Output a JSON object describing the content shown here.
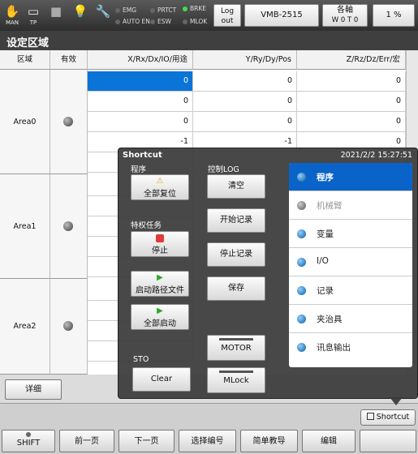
{
  "topbar": {
    "icons": [
      {
        "name": "man-icon",
        "label": "MAN"
      },
      {
        "name": "tp-icon",
        "label": "TP"
      },
      {
        "name": "stop-square-icon",
        "label": ""
      },
      {
        "name": "lightbulb-icon",
        "label": ""
      },
      {
        "name": "wrench-warning-icon",
        "label": ""
      }
    ],
    "indicators": {
      "emg": "EMG",
      "auto_en": "AUTO EN",
      "prtct": "PRTCT",
      "esw": "ESW",
      "brke": "BRKE",
      "mlok": "MLOK"
    },
    "logout_label": "Log out",
    "robot_label": "VMB-2515",
    "axis_label": "各軸",
    "axis_sub": "W 0 T 0",
    "speed": "1 %"
  },
  "title": "设定区域",
  "table": {
    "headers": [
      "区域",
      "有效",
      "X/Rx/Dx/IO/用途",
      "Y/Ry/Dy/Pos",
      "Z/Rz/Dz/Err/宏"
    ],
    "rows": [
      {
        "x": "0",
        "y": "0",
        "z": "0"
      },
      {
        "x": "0",
        "y": "0",
        "z": "0"
      },
      {
        "x": "0",
        "y": "0",
        "z": "0"
      },
      {
        "x": "-1",
        "y": "-1",
        "z": "0"
      }
    ],
    "areas": [
      "Area0",
      "Area1",
      "Area2"
    ]
  },
  "detail_label": "详细",
  "shortcut_button": "Shortcut",
  "panel": {
    "title": "Shortcut",
    "datetime": "2021/2/2 15:27:51",
    "program_label": "程序",
    "reset_all": "全部复位",
    "privileged_label": "特权任务",
    "stop": "停止",
    "start_path": "启动路径文件",
    "start_all": "全部启动",
    "sto_label": "STO",
    "clear": "Clear",
    "log_label": "控制LOG",
    "log_clear": "清空",
    "log_start": "开始记录",
    "log_stop": "停止记录",
    "log_save": "保存",
    "motor": "MOTOR",
    "mlock": "MLock",
    "menu": [
      {
        "label": "程序",
        "state": "active"
      },
      {
        "label": "机械臂",
        "state": "disabled"
      },
      {
        "label": "变量",
        "state": "normal"
      },
      {
        "label": "I/O",
        "state": "normal"
      },
      {
        "label": "记录",
        "state": "normal"
      },
      {
        "label": "夹治具",
        "state": "normal"
      },
      {
        "label": "讯息输出",
        "state": "normal"
      }
    ]
  },
  "footer": [
    "SHIFT",
    "前一页",
    "下一页",
    "选择编号",
    "简单教导",
    "编辑",
    ""
  ],
  "colors": {
    "accent": "#0a63c9",
    "selection": "#0a74d8",
    "brke_on": "#3fe04a"
  }
}
